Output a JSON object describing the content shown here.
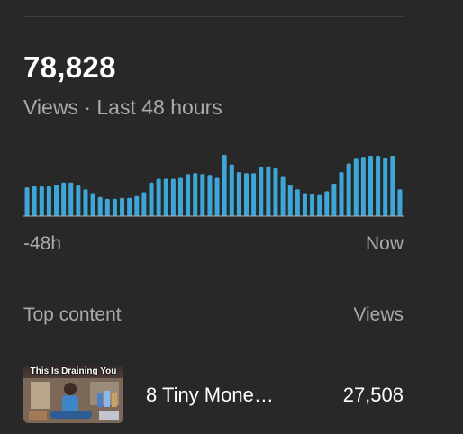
{
  "summary": {
    "total_views": "78,828",
    "period_label": "Views · Last 48 hours"
  },
  "chart_data": {
    "type": "bar",
    "title": "",
    "x_start_label": "-48h",
    "x_end_label": "Now",
    "color": "#3ea6d6",
    "values": [
      30,
      31,
      31,
      31,
      33,
      35,
      35,
      32,
      28,
      24,
      20,
      18,
      18,
      19,
      19,
      21,
      25,
      35,
      39,
      39,
      39,
      40,
      44,
      45,
      44,
      43,
      40,
      64,
      54,
      46,
      45,
      45,
      51,
      52,
      50,
      41,
      33,
      28,
      24,
      23,
      22,
      26,
      34,
      46,
      55,
      60,
      62,
      63,
      63,
      61,
      63,
      28
    ]
  },
  "top_content": {
    "header_left": "Top content",
    "header_right": "Views",
    "items": [
      {
        "thumbnail_text": "This Is Draining You",
        "title": "8 Tiny Mone…",
        "views": "27,508"
      }
    ]
  }
}
